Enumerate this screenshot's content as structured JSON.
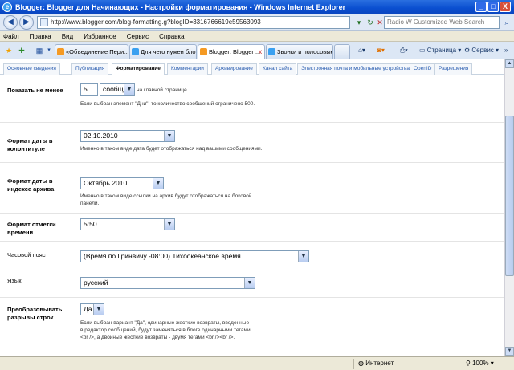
{
  "window": {
    "title": "Blogger: Blogger для Начинающих - Настройки форматирования - Windows Internet Explorer",
    "min": "_",
    "max": "□",
    "close": "X"
  },
  "address": {
    "url": "http://www.blogger.com/blog-formatting.g?blogID=3316766619e59563093",
    "search_placeholder": "Radio W Customized Web Search"
  },
  "menu": [
    "Файл",
    "Правка",
    "Вид",
    "Избранное",
    "Сервис",
    "Справка"
  ],
  "tabs": [
    {
      "label": "«Объединение Пери..."
    },
    {
      "label": "Для чего нужен бло..."
    },
    {
      "label": "Blogger: Blogger ...",
      "close": "x"
    },
    {
      "label": "Звонки и полосовые..."
    }
  ],
  "toolbar": {
    "page": "Страница",
    "tools": "Сервис"
  },
  "subnav": [
    "Основные сведения",
    "Публикация",
    "Форматирование",
    "Комментарии",
    "Архивирование",
    "Канал сайта",
    "Электронная почта и мобильные устройства",
    "OpenID",
    "Разрешения"
  ],
  "form": {
    "show": {
      "label": "Показать не менее",
      "count": "5",
      "unit": "сообщ...",
      "after": "на главной странице.",
      "hint": "Если выбран элемент \"Дни\", то количество сообщений ограничено 500."
    },
    "header_date": {
      "label": "Формат даты в колонтитуле",
      "value": "02.10.2010",
      "hint": "Именно в таком виде дата будет отображаться над вашими сообщениями."
    },
    "archive_date": {
      "label": "Формат даты в индексе архива",
      "value": "Октябрь 2010",
      "hint": "Именно в таком виде ссылки на архив будут отображаться на боковой панели."
    },
    "timestamp": {
      "label": "Формат отметки времени",
      "value": "5:50"
    },
    "timezone": {
      "label": "Часовой пояс",
      "value": "(Время по Гринвичу -08:00) Тихоокеанское время"
    },
    "language": {
      "label": "Язык",
      "value": "русский"
    },
    "linebreaks": {
      "label": "Преобразовывать разрывы строк",
      "value": "Да",
      "hint": "Если выбран вариант \"Да\", одинарные жесткие возвраты, введенные в редактор сообщений, будут заменяться в блоге одинарными тегами <br />, а двойные жесткие возвраты - двумя тегами <br /><br />."
    }
  },
  "status": {
    "zone": "Интернет",
    "zoom": "100%"
  }
}
